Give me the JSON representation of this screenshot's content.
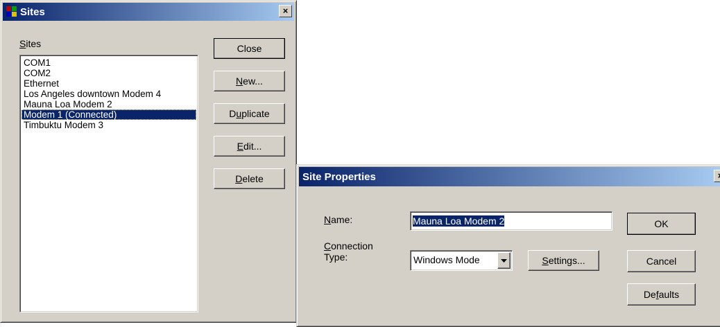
{
  "sites_dialog": {
    "title": "Sites",
    "list_label_accel": "S",
    "list_label_rest": "ites",
    "items": [
      "COM1",
      "COM2",
      "Ethernet",
      "Los Angeles downtown Modem 4",
      "Mauna Loa Modem 2",
      "Modem 1 (Connected)",
      "Timbuktu Modem 3"
    ],
    "selected_item": "Modem 1 (Connected)",
    "buttons": {
      "close": "Close",
      "new_accel": "N",
      "new_rest": "ew...",
      "dup_pre": "D",
      "dup_accel": "u",
      "dup_rest": "plicate",
      "edit_accel": "E",
      "edit_rest": "dit...",
      "delete_accel": "D",
      "delete_rest": "elete"
    },
    "close_glyph": "×"
  },
  "site_properties": {
    "title": "Site Properties",
    "name_label_accel": "N",
    "name_label_rest": "ame:",
    "name_value": "Mauna Loa Modem 2",
    "conn_label_accel": "C",
    "conn_label_rest1": "onnection",
    "conn_label_line2": "Type:",
    "conn_type_value": "Windows Mode",
    "buttons": {
      "settings_accel": "S",
      "settings_rest": "ettings...",
      "ok": "OK",
      "cancel": "Cancel",
      "defaults_pre": "De",
      "defaults_accel": "f",
      "defaults_rest": "aults"
    },
    "close_glyph": "×"
  },
  "colors": {
    "title_gradient_start": "#0a246a",
    "title_gradient_end": "#a6caf0",
    "selection": "#0a246a",
    "face": "#d4d0c8"
  }
}
